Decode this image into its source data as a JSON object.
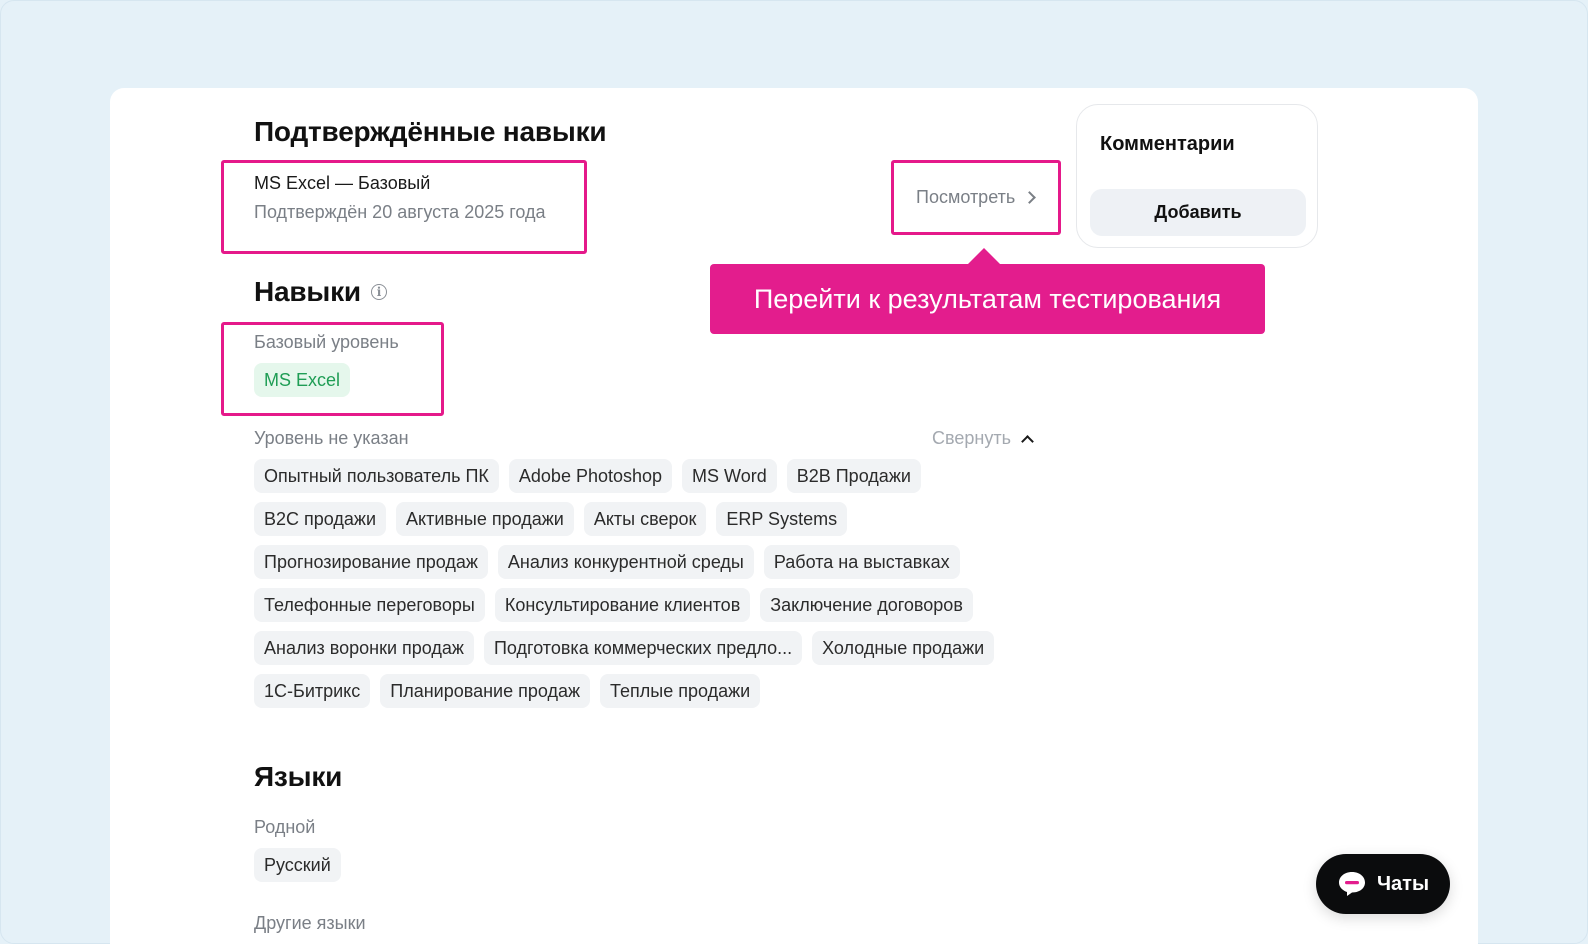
{
  "confirmed": {
    "title": "Подтверждённые навыки",
    "skill": "MS Excel — Базовый",
    "date": "Подтверждён 20 августа 2025 года",
    "view_label": "Посмотреть"
  },
  "comments": {
    "title": "Комментарии",
    "add_label": "Добавить"
  },
  "tooltip": {
    "text": "Перейти к результатам тестирования"
  },
  "skills": {
    "title": "Навыки",
    "basic_label": "Базовый уровень",
    "basic_tags": [
      "MS Excel"
    ],
    "unspecified_label": "Уровень не указан",
    "collapse_label": "Свернуть",
    "tags": [
      [
        "Опытный пользователь ПК",
        "Adobe Photoshop",
        "MS Word",
        "B2B Продажи"
      ],
      [
        "B2C продажи",
        "Активные продажи",
        "Акты сверок",
        "ERP Systems"
      ],
      [
        "Прогнозирование продаж",
        "Анализ конкурентной среды",
        "Работа на выставках"
      ],
      [
        "Телефонные переговоры",
        "Консультирование клиентов",
        "Заключение договоров"
      ],
      [
        "Анализ воронки продаж",
        "Подготовка коммерческих предло...",
        "Холодные продажи"
      ],
      [
        "1С-Битрикс",
        "Планирование продаж",
        "Теплые продажи"
      ]
    ]
  },
  "languages": {
    "title": "Языки",
    "native_label": "Родной",
    "native": [
      "Русский"
    ],
    "other_label": "Другие языки"
  },
  "chats": {
    "label": "Чаты"
  },
  "colors": {
    "accent": "#e31d8d",
    "background": "#e5f1f8",
    "green_tag_text": "#1f9d55",
    "green_tag_bg": "#e5f7ec"
  }
}
